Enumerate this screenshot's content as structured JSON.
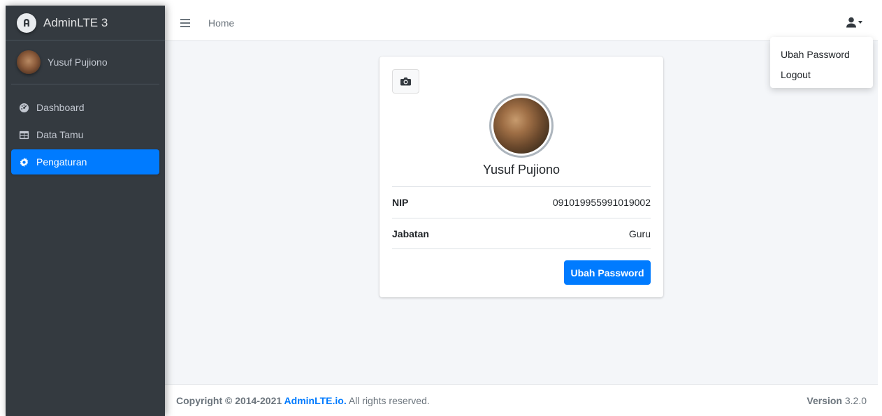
{
  "brand": {
    "title": "AdminLTE 3"
  },
  "user_panel": {
    "name": "Yusuf Pujiono"
  },
  "sidebar": {
    "items": [
      {
        "label": "Dashboard",
        "icon": "dashboard-icon",
        "active": false
      },
      {
        "label": "Data Tamu",
        "icon": "table-icon",
        "active": false
      },
      {
        "label": "Pengaturan",
        "icon": "gear-icon",
        "active": true
      }
    ]
  },
  "navbar": {
    "home_label": "Home",
    "user_icon": "user-icon"
  },
  "dropdown": {
    "items": [
      "Ubah Password",
      "Logout"
    ]
  },
  "profile": {
    "name": "Yusuf Pujiono",
    "rows": [
      {
        "label": "NIP",
        "value": "091019955991019002"
      },
      {
        "label": "Jabatan",
        "value": "Guru"
      }
    ],
    "button_label": "Ubah Password"
  },
  "footer": {
    "copyright_prefix": "Copyright © 2014-2021 ",
    "link": "AdminLTE.io.",
    "suffix": " All rights reserved.",
    "version_label": "Version",
    "version_value": "3.2.0"
  },
  "colors": {
    "primary": "#007bff",
    "sidebar": "#343a40",
    "content_bg": "#f4f6f9"
  }
}
